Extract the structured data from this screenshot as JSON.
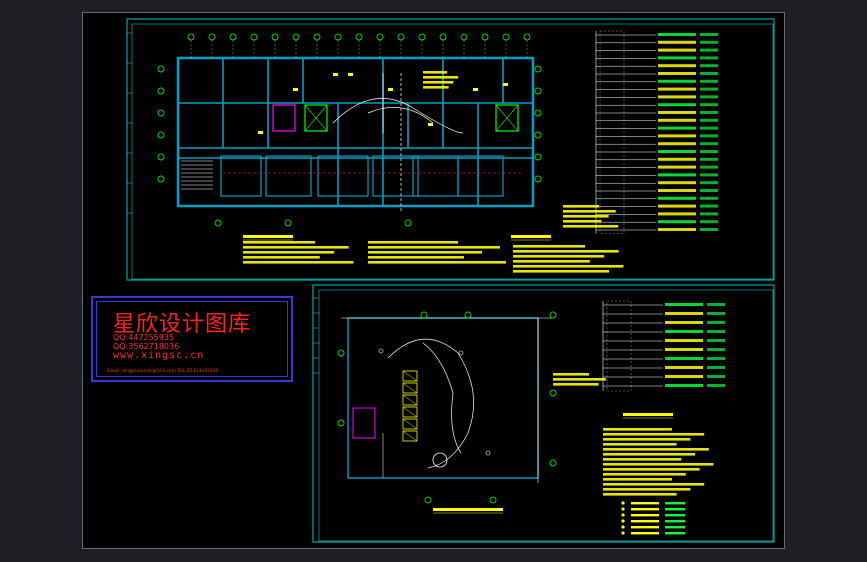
{
  "watermark": {
    "title": "星欣设计图库",
    "qq1": "QQ:447255935",
    "qq2": "QQ:3562718036",
    "url": "www.xingsc.cn",
    "footer": "Email: xingscsource@163.com  TEL:15113342400"
  },
  "colors": {
    "canvas": "#000000",
    "frame": "#00c8c8",
    "walls": "#00a0c8",
    "axis_bubble": "#00d000",
    "text_yellow": "#ffff00",
    "text_green": "#00ff40",
    "watermark_red": "#ff2020",
    "watermark_border": "#3a38d8",
    "magenta": "#ff00ff"
  }
}
